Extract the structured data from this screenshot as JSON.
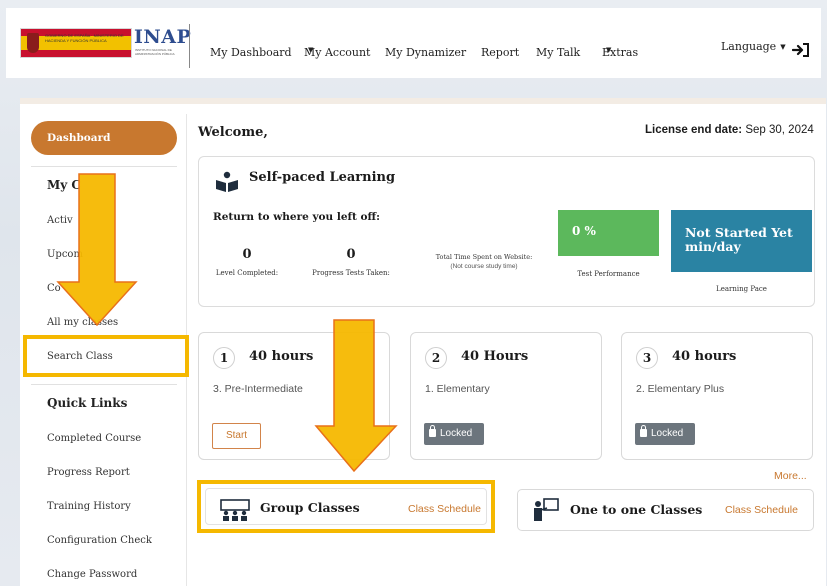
{
  "header": {
    "logo_gov_text": "GOBIERNO DE ESPAÑA · MINISTERIO DE HACIENDA Y FUNCIÓN PÚBLICA",
    "logo_brand": "INAP",
    "logo_brand_sub": "INSTITUTO NACIONAL DE ADMINISTRACIÓN PÚBLICA",
    "nav": [
      {
        "label": "My Dashboard",
        "dropdown": false
      },
      {
        "label": "My Account",
        "dropdown": true
      },
      {
        "label": "My Dynamizer",
        "dropdown": false
      },
      {
        "label": "Report",
        "dropdown": false
      },
      {
        "label": "My Talk",
        "dropdown": false
      },
      {
        "label": "Extras",
        "dropdown": true
      }
    ],
    "language_label": "Language",
    "logout_icon": "logout-icon"
  },
  "sidebar": {
    "dashboard_label": "Dashboard",
    "my_classes_heading": "My C",
    "items": [
      {
        "label": "Activ"
      },
      {
        "label": "Upcom"
      },
      {
        "label": "Co"
      },
      {
        "label": "All my classes"
      },
      {
        "label": "Search Class"
      }
    ],
    "quick_links_heading": "Quick Links",
    "quick_links": [
      {
        "label": "Completed Course"
      },
      {
        "label": "Progress Report"
      },
      {
        "label": "Training History"
      },
      {
        "label": "Configuration Check"
      },
      {
        "label": "Change Password"
      }
    ]
  },
  "main": {
    "welcome": "Welcome,",
    "license_label": "License end date:",
    "license_value": " Sep 30, 2024",
    "self_paced": {
      "title": "Self-paced Learning",
      "return_text": "Return to where you left off:",
      "level_completed_value": "0",
      "level_completed_label": "Level Completed:",
      "progress_tests_value": "0",
      "progress_tests_label": "Progress Tests Taken:",
      "time_spent_label": "Total Time Spent on Website:",
      "time_spent_sub": "(Not course study time)",
      "test_performance_value": "0 %",
      "test_performance_label": "Test Performance",
      "learning_pace_value": "Not Started Yet min/day",
      "learning_pace_label": "Learning Pace"
    },
    "courses": [
      {
        "number": "1",
        "hours": "40 hours",
        "name": "3. Pre-Intermediate",
        "action": "Start"
      },
      {
        "number": "2",
        "hours": "40 Hours",
        "name": "1. Elementary",
        "action": "Locked"
      },
      {
        "number": "3",
        "hours": "40 hours",
        "name": "2. Elementary Plus",
        "action": "Locked"
      }
    ],
    "more_label": "More...",
    "group_classes": {
      "label": "Group Classes",
      "schedule": "Class Schedule"
    },
    "one_to_one": {
      "label": "One to one Classes",
      "schedule": "Class Schedule"
    }
  },
  "colors": {
    "accent_orange": "#c8782f",
    "highlight_yellow": "#f5b800",
    "performance_green": "#5cb85c",
    "pace_blue": "#2a83a3",
    "locked_gray": "#6c757d",
    "brand_blue": "#2e4d8f"
  }
}
